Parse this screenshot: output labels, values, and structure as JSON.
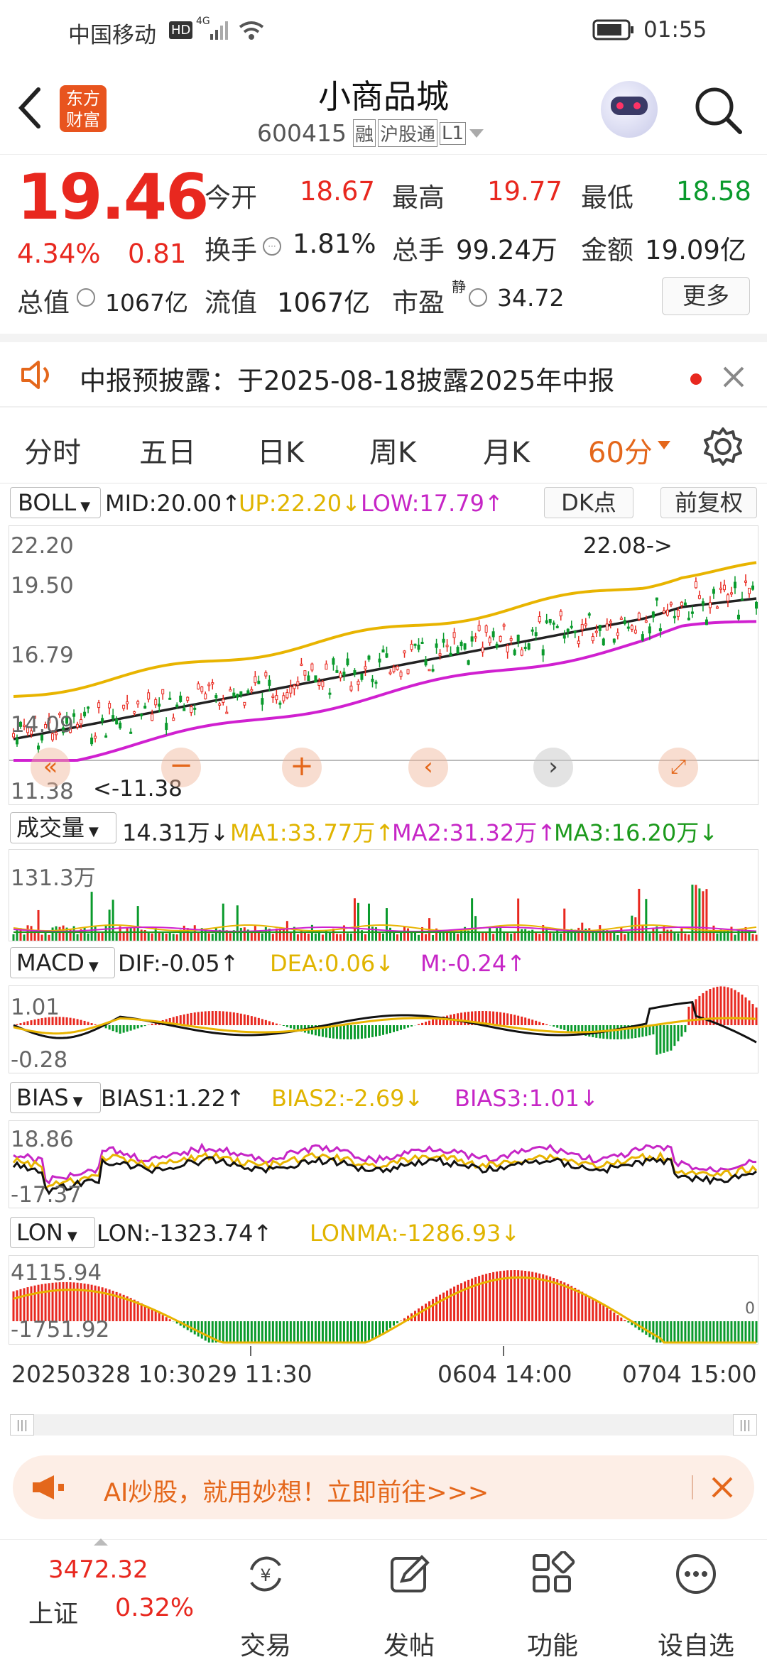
{
  "status_bar": {
    "carrier": "中国移动",
    "network": "4G",
    "time": "01:55",
    "hd": "HD"
  },
  "header": {
    "logo": "东方财富",
    "title": "小商品城",
    "code": "600415",
    "tags": [
      "融",
      "沪股通",
      "L1"
    ]
  },
  "quote": {
    "price": "19.46",
    "change_pct": "4.34%",
    "change": "0.81",
    "open_label": "今开",
    "open": "18.67",
    "high_label": "最高",
    "high": "19.77",
    "low_label": "最低",
    "low": "18.58",
    "turnover_label": "换手",
    "turnover": "1.81%",
    "volume_label": "总手",
    "volume": "99.24万",
    "amount_label": "金额",
    "amount": "19.09亿",
    "mktcap_label": "总值",
    "mktcap": "1067亿",
    "float_label": "流值",
    "float": "1067亿",
    "pe_label": "市盈",
    "pe_sup": "静",
    "pe": "34.72",
    "more": "更多"
  },
  "notice": {
    "text": "中报预披露：于2025-08-18披露2025年中报"
  },
  "tabs": [
    "分时",
    "五日",
    "日K",
    "周K",
    "月K",
    "60分"
  ],
  "main_chart": {
    "indicator": "BOLL",
    "mid": "MID:20.00↑",
    "up": "UP:22.20↓",
    "low": "LOW:17.79↑",
    "dk_button": "DK点",
    "fq_button": "前复权",
    "y_ticks": [
      "22.20",
      "19.50",
      "16.79",
      "14.09",
      "11.38"
    ],
    "max_label": "22.08->",
    "min_label": "<-11.38"
  },
  "volume": {
    "label": "成交量",
    "value": "14.31万↓",
    "ma1": "MA1:33.77万↑",
    "ma2": "MA2:31.32万↑",
    "ma3": "MA3:16.20万↓",
    "y_top": "131.3万"
  },
  "macd": {
    "label": "MACD",
    "dif": "DIF:-0.05↑",
    "dea": "DEA:0.06↓",
    "m": "M:-0.24↑",
    "y_top": "1.01",
    "y_bottom": "-0.28"
  },
  "bias": {
    "label": "BIAS",
    "b1": "BIAS1:1.22↑",
    "b2": "BIAS2:-2.69↓",
    "b3": "BIAS3:1.01↓",
    "y_top": "18.86",
    "y_bottom": "-17.37"
  },
  "lon": {
    "label": "LON",
    "lon": "LON:-1323.74↑",
    "lonma": "LONMA:-1286.93↓",
    "y_top": "4115.94",
    "y_bottom": "-1751.92",
    "y_right": "0"
  },
  "x_axis": [
    "20250328 10:30",
    "29 11:30",
    "0604 14:00",
    "0704 15:00"
  ],
  "ad": {
    "text": "AI炒股，就用妙想！立即前往>>>"
  },
  "bottom_nav": {
    "index_value": "3472.32",
    "index_name": "上证",
    "index_change": "0.32%",
    "items": [
      "交易",
      "发帖",
      "功能",
      "设自选"
    ]
  },
  "colors": {
    "up": "#e8281f",
    "down": "#0a9a2c",
    "accent": "#e4671b",
    "boll_up": "#e8b400",
    "boll_low": "#d020d0"
  }
}
